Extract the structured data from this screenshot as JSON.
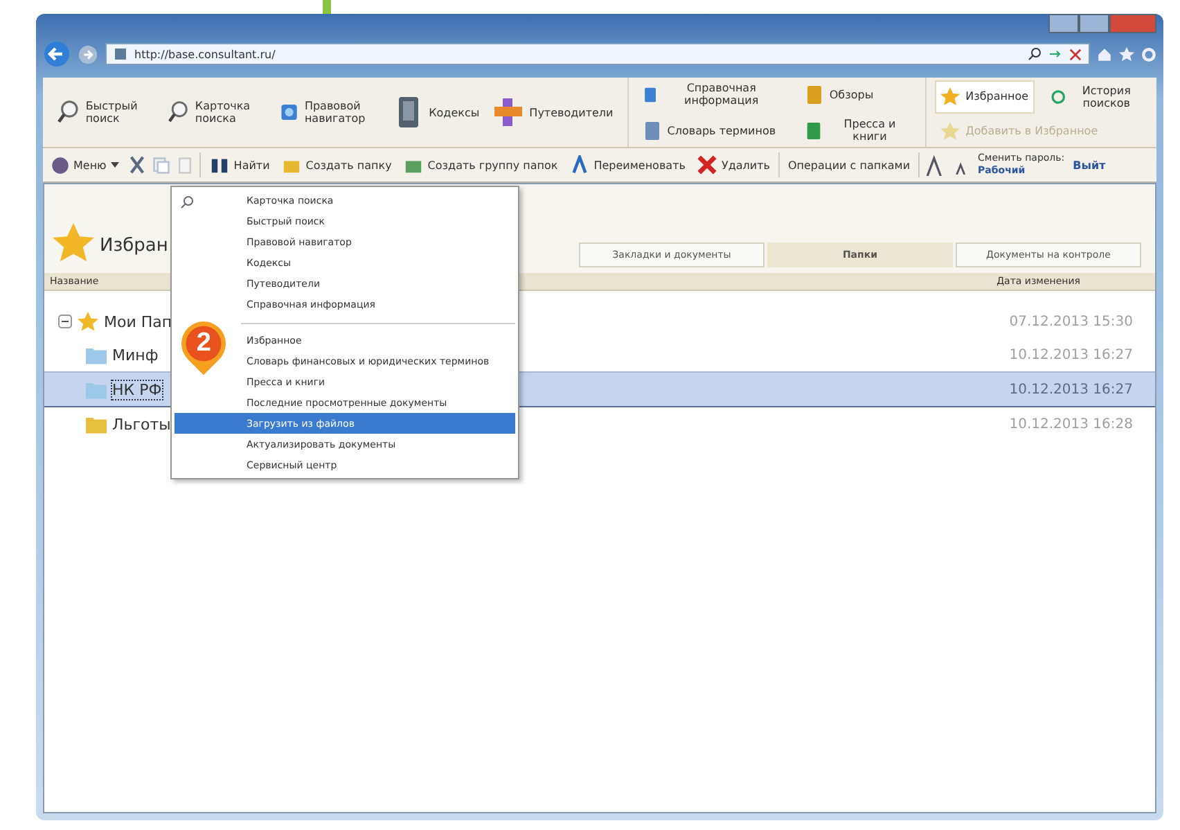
{
  "browser": {
    "address": "http://base.consultant.ru/"
  },
  "ribbon": {
    "search_tools": [
      {
        "label": "Быстрый поиск"
      },
      {
        "label": "Карточка поиска"
      },
      {
        "label": "Правовой навигатор"
      },
      {
        "label": "Кодексы"
      },
      {
        "label": "Путеводители"
      }
    ],
    "reference_tools": [
      {
        "label": "Справочная информация"
      },
      {
        "label": "Словарь терминов"
      },
      {
        "label": "Обзоры"
      },
      {
        "label": "Пресса и книги"
      }
    ],
    "favorites_tools": [
      {
        "label": "Избранное",
        "selected": true
      },
      {
        "label": "История поисков",
        "selected": false
      }
    ],
    "add_favorite": {
      "label": "Добавить в Избранное",
      "disabled": true
    }
  },
  "toolbar": {
    "menu": "Меню",
    "actions": [
      "Найти",
      "Создать папку",
      "Создать группу папок",
      "Переименовать",
      "Удалить"
    ],
    "operations": "Операции с папками",
    "password_label": "Сменить пароль:",
    "password_value": "Рабочий",
    "exit": "Выйт"
  },
  "panel": {
    "title": "Избран",
    "tabs": [
      {
        "label": "Закладки и документы",
        "selected": false
      },
      {
        "label": "Папки",
        "selected": true
      },
      {
        "label": "Документы на контроле",
        "selected": false
      }
    ],
    "columns": [
      "Название",
      "Дата изменения"
    ],
    "tree": [
      {
        "name": "Мои Пап",
        "date": "07.12.2013 15:30",
        "selected": false,
        "expanded": true,
        "children": [
          {
            "name": "Минф",
            "date": "10.12.2013 16:27",
            "selected": false
          },
          {
            "name": "НК РФ",
            "date": "10.12.2013 16:27",
            "selected": true
          },
          {
            "name": "Льготы",
            "date": "10.12.2013 16:28",
            "selected": false
          }
        ]
      }
    ]
  },
  "menu": {
    "groups": [
      [
        {
          "label": "Карточка поиска",
          "selected": false
        },
        {
          "label": "Быстрый поиск",
          "selected": false
        },
        {
          "label": "Правовой навигатор",
          "selected": false
        },
        {
          "label": "Кодексы",
          "selected": false
        },
        {
          "label": "Путеводители",
          "selected": false
        },
        {
          "label": "Справочная информация",
          "selected": false
        }
      ],
      [
        {
          "label": "Избранное",
          "selected": false
        },
        {
          "label": "Словарь финансовых и юридических терминов",
          "selected": false
        },
        {
          "label": "Пресса и книги",
          "selected": false
        },
        {
          "label": "Последние просмотренные документы",
          "selected": false
        },
        {
          "label": "Загрузить из файлов",
          "selected": true
        },
        {
          "label": "Актуализировать документы",
          "selected": false
        },
        {
          "label": "Сервисный центр",
          "selected": false
        }
      ]
    ]
  },
  "step_marker": "2"
}
